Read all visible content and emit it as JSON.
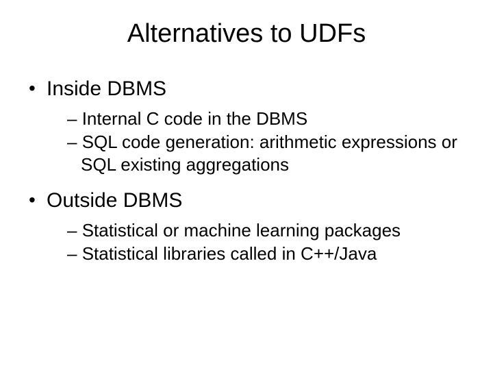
{
  "title": "Alternatives to UDFs",
  "bullets": [
    {
      "text": "Inside DBMS",
      "sub": [
        "Internal C code in the DBMS",
        "SQL code generation: arithmetic expressions or SQL existing aggregations"
      ]
    },
    {
      "text": "Outside DBMS",
      "sub": [
        "Statistical or machine learning packages",
        "Statistical libraries called in C++/Java"
      ]
    }
  ]
}
